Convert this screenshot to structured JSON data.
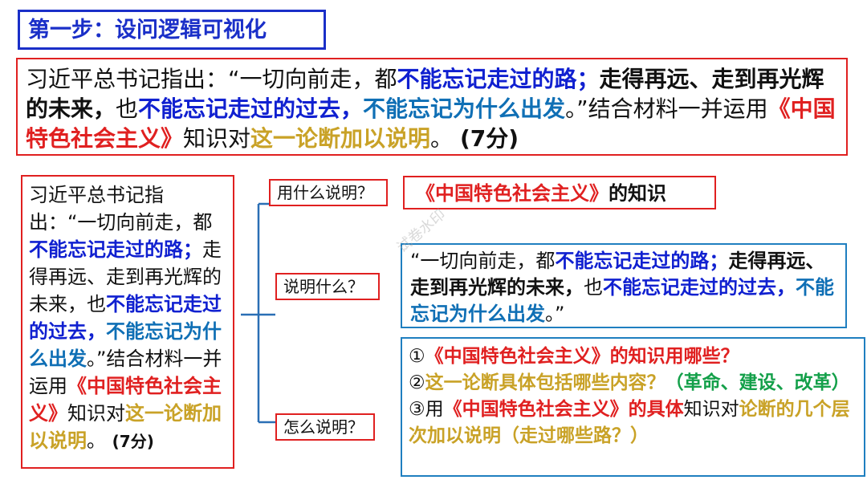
{
  "step_title": "第一步：设问逻辑可视化",
  "question": {
    "s1": "习近平总书记指出：“一切向前走，都",
    "s2": "不能忘记走过的路；",
    "s3": "走得再远、走到再光辉的未来，",
    "s4": "也",
    "s5": "不能忘记走过的过去，",
    "s6": "不能忘记为什么出发",
    "s7": "。”结合材料一并运用",
    "s8": "《中国特色社会主义》",
    "s9": "知识对",
    "s10": "这一论断加以说明",
    "s11": "。",
    "s12": "(7分)"
  },
  "left_box": {
    "s1": "习近平总书记指出：“一切向前走，都",
    "s2": "不能忘记走过的路；",
    "s3": "走得再远、走到再光辉的未来，也",
    "s4": "不能忘记走过的过去，",
    "s5": "不能忘记为什么出发",
    "s6": "。”结合材料一并运用",
    "s7": "《中国特色社会主义》",
    "s8": "知识对",
    "s9": "这一论断加以说明",
    "s10": "。",
    "s11": "(7分)"
  },
  "labels": {
    "what": "用什么说明？",
    "which": "说明什么？",
    "how": "怎么说明？"
  },
  "answer_1": {
    "red": "《中国特色社会主义》",
    "dark": "的知识"
  },
  "answer_2": {
    "s1": "“一切向前走，都",
    "s2": "不能忘记走过的路；",
    "s3": "走得再远、走到再光辉的未来，",
    "s4": "也",
    "s5": "不能忘记走过的过去，",
    "s6": "不能忘记为什么出发",
    "s7": "。”"
  },
  "answer_3": {
    "l1_num": "①",
    "l1_red": "《中国特色社会主义》",
    "l1_rest": "的知识用哪些？",
    "l2_num": "②",
    "l2_gold": "这一论断具体包括哪些内容？",
    "l2_green": "（革命、建设、改革）",
    "l3_num": "③",
    "l3_a": "用",
    "l3_red": "《中国特色社会主义》",
    "l3_b": "的具体",
    "l3_c": "知识对",
    "l3_gold": "论断的几个层次加以说明（走过哪些路？）"
  },
  "watermark": "试卷水印"
}
